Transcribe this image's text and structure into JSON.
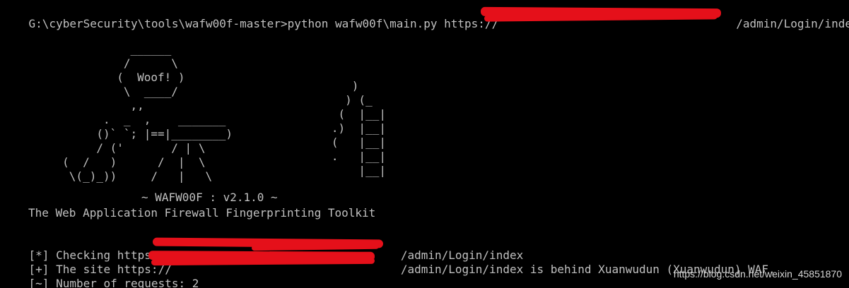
{
  "terminal": {
    "command_prompt": "G:\\cyberSecurity\\tools\\wafw00f-master>",
    "command": "python wafw00f\\main.py https://",
    "command_tail": "/admin/Login/index",
    "banner": {
      "dog_art": "               ______\n              /      \\\n             (  Woof! )\n              \\  ____/\n               ,,\n           .  _  ,    _______\n          ()` `; |==|________)\n          / ('       / | \\\n     (  /   )      /  |  \\\n      \\(_)_))     /   |   \\",
      "fire_art": "      )\n     ) (_\n    (  |__|\n   .)  |__|\n   (   |__|\n   .   |__|\n       |__|",
      "title": "~ WAFW00F : v2.1.0 ~",
      "subtitle": "The Web Application Firewall Fingerprinting Toolkit"
    },
    "output": [
      {
        "prefix": "[*]",
        "text_before": " Checking https://",
        "text_after": "/admin/Login/index"
      },
      {
        "prefix": "[+]",
        "text_before": " The site https://",
        "text_after": "/admin/Login/index is behind Xuanwudun (Xuanwudun) WAF."
      },
      {
        "prefix": "[~]",
        "text_before": " Number of requests: 2",
        "text_after": ""
      }
    ],
    "colors": {
      "background": "#000000",
      "text": "#c0c0c0",
      "redaction": "#e5101a"
    }
  },
  "watermark": "https://blog.csdn.net/weixin_45851870"
}
